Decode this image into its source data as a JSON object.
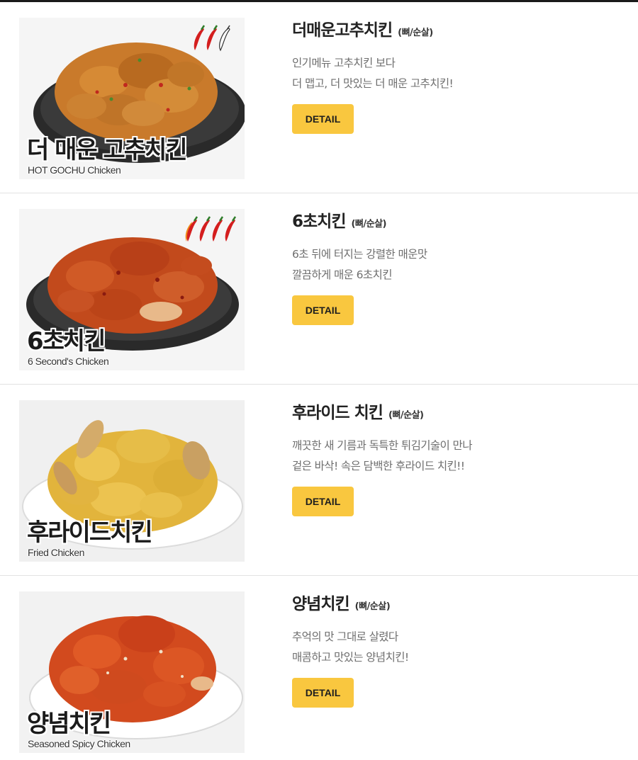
{
  "menu": {
    "items": [
      {
        "name": "더매운고추치킨",
        "type": "(뼈/순살)",
        "desc1": "인기메뉴 고추치킨 보다",
        "desc2": "더 맵고, 더 맛있는 더 매운 고추치킨!",
        "button": "DETAIL",
        "image_title": "더 매운 고추치킨",
        "image_subtitle": "HOT GOCHU Chicken",
        "spice_level": 3,
        "icon": "chili-pepper-icon"
      },
      {
        "name": "6초치킨",
        "type": "(뼈/순살)",
        "desc1": "6초 뒤에 터지는 강렬한 매운맛",
        "desc2": "깔끔하게 매운 6초치킨",
        "button": "DETAIL",
        "image_title": "6초치킨",
        "image_subtitle": "6 Second's Chicken",
        "spice_level": 4,
        "icon": "chili-pepper-icon"
      },
      {
        "name": "후라이드 치킨",
        "type": "(뼈/순살)",
        "desc1": "깨끗한 새 기름과 독특한 튀김기술이 만나",
        "desc2": "겉은 바삭! 속은 담백한 후라이드 치킨!!",
        "button": "DETAIL",
        "image_title": "후라이드치킨",
        "image_subtitle": "Fried Chicken"
      },
      {
        "name": "양념치킨",
        "type": "(뼈/순살)",
        "desc1": "추억의 맛 그대로 살렸다",
        "desc2": "매콤하고 맛있는 양념치킨!",
        "button": "DETAIL",
        "image_title": "양념치킨",
        "image_subtitle": "Seasoned Spicy Chicken"
      }
    ]
  },
  "colors": {
    "accent": "#f9c73f",
    "title": "#222222",
    "description": "#6e6e6e",
    "divider": "#e2e2e2"
  }
}
